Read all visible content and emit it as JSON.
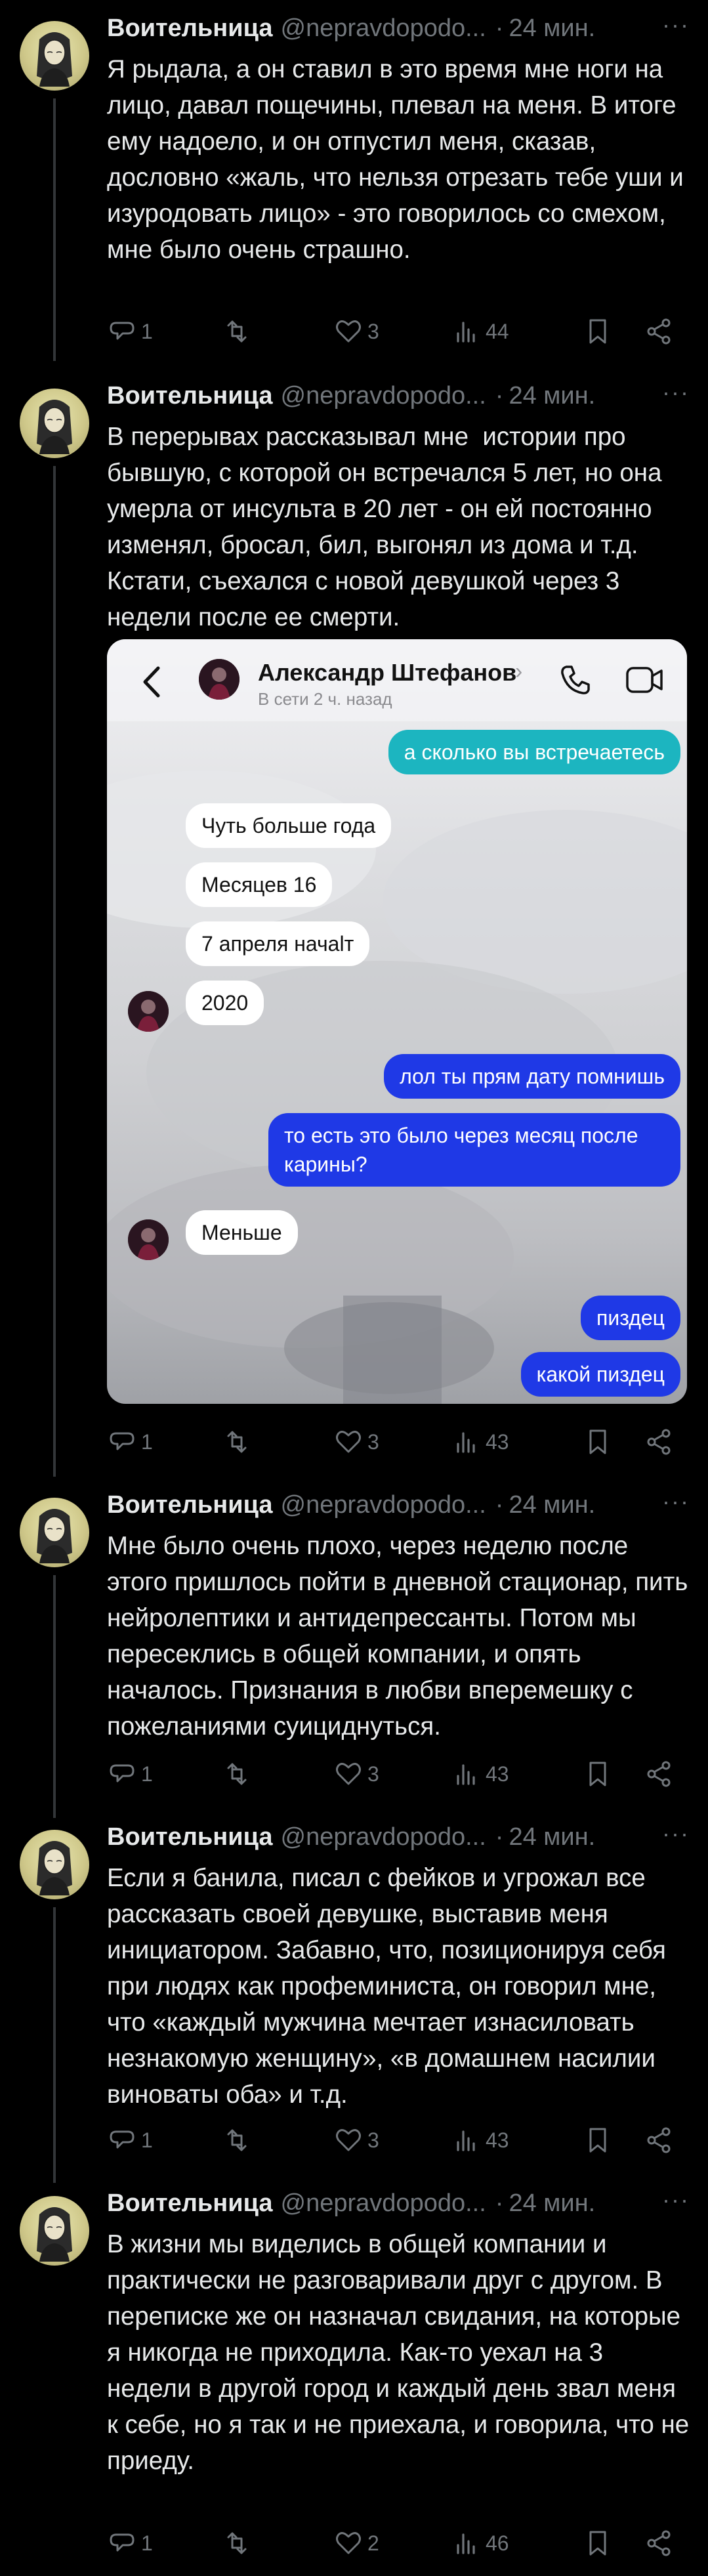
{
  "author": {
    "name": "Воительница",
    "handle": "@nepravdopodo...",
    "separator": "·"
  },
  "tweets": [
    {
      "time": "24 мин.",
      "text": "Я рыдала, а он ставил в это время мне ноги на лицо, давал пощечины, плевал на меня. В итоге ему надоело, и он отпустил меня, сказав, дословно «жаль, что нельзя отрезать тебе уши и изуродовать лицо» - это говорилось со смехом, мне было очень страшно.",
      "replies": "1",
      "retweets": "",
      "likes": "3",
      "views": "44"
    },
    {
      "time": "24 мин.",
      "text": "В перерывах рассказывал мне  истории про бывшую, с которой он встречался 5 лет, но она умерла от инсульта в 20 лет - он ей постоянно изменял, бросал, бил, выгонял из дома и т.д. Кстати, съехался с новой девушкой через 3 недели после ее смерти.",
      "replies": "1",
      "retweets": "",
      "likes": "3",
      "views": "43"
    },
    {
      "time": "24 мин.",
      "text": "Мне было очень плохо, через неделю после этого пришлось пойти в дневной стационар, пить нейролептики и антидепрессанты. Потом мы пересеклись в общей компании, и опять началось. Признания в любви вперемешку с пожеланиями суициднуться.",
      "replies": "1",
      "retweets": "",
      "likes": "3",
      "views": "43"
    },
    {
      "time": "24 мин.",
      "text": "Если я банила, писал с фейков и угрожал все рассказать своей девушке, выставив меня инициатором. Забавно, что, позиционируя себя при людях как профеминиста, он говорил мне, что «каждый мужчина мечтает изнасиловать незнакомую женщину», «в домашнем насилии виноваты оба» и т.д.",
      "replies": "1",
      "retweets": "",
      "likes": "3",
      "views": "43"
    },
    {
      "time": "24 мин.",
      "text": "В жизни мы виделись в общей компании и практически не разговаривали друг с другом. В переписке же он назначал свидания, на которые я никогда не приходила. Как-то уехал на 3 недели в другой город и каждый день звал меня к себе, но я так и не приехала, и говорила, что не приеду.",
      "replies": "1",
      "retweets": "",
      "likes": "2",
      "views": "46"
    }
  ],
  "chat": {
    "contact_name": "Александр Штефанов",
    "status": "В сети 2 ч. назад",
    "messages": [
      "а сколько вы встречаетесь",
      "Чуть больше года",
      "Месяцев 16",
      "7 апреля начalт",
      "2020",
      "лол ты прям дату помнишь",
      "то есть это было через месяц после\nкарины?",
      "Меньше",
      "пиздец",
      "какой пиздец"
    ]
  },
  "icons": [
    "reply-icon",
    "retweet-icon",
    "like-icon",
    "views-icon",
    "bookmark-icon",
    "share-icon",
    "more-icon",
    "back-icon",
    "phone-icon",
    "video-icon"
  ],
  "colors": {
    "background": "#000000",
    "text": "#e7e9ea",
    "muted": "#71767b",
    "outgoing_bubble": "#1f39e6",
    "teal_bubble": "#1cb5c0"
  }
}
